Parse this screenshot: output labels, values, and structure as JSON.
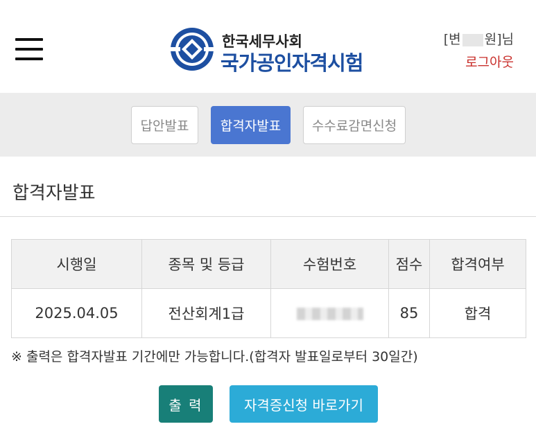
{
  "header": {
    "logo_org": "한국세무사회",
    "logo_title": "국가공인자격시험",
    "user_prefix": "[변",
    "user_suffix": "원]님",
    "logout_label": "로그아웃"
  },
  "tabs": [
    {
      "label": "답안발표",
      "active": false
    },
    {
      "label": "합격자발표",
      "active": true
    },
    {
      "label": "수수료감면신청",
      "active": false
    }
  ],
  "section": {
    "title": "합격자발표"
  },
  "table": {
    "headers": [
      "시행일",
      "종목 및 등급",
      "수험번호",
      "점수",
      "합격여부"
    ],
    "rows": [
      {
        "date": "2025.04.05",
        "subject": "전산회계1급",
        "exam_number": "",
        "score": "85",
        "result": "합격"
      }
    ]
  },
  "notice": "※ 출력은 합격자발표 기간에만 가능합니다.(합격자 발표일로부터 30일간)",
  "buttons": {
    "print_label": "출 력",
    "cert_label": "자격증신청 바로가기"
  },
  "colors": {
    "brand_blue": "#1d4fa1",
    "tab_active": "#4a76d1",
    "print_button": "#187f78",
    "cert_button": "#2cabd7",
    "logout": "#c9302c"
  }
}
